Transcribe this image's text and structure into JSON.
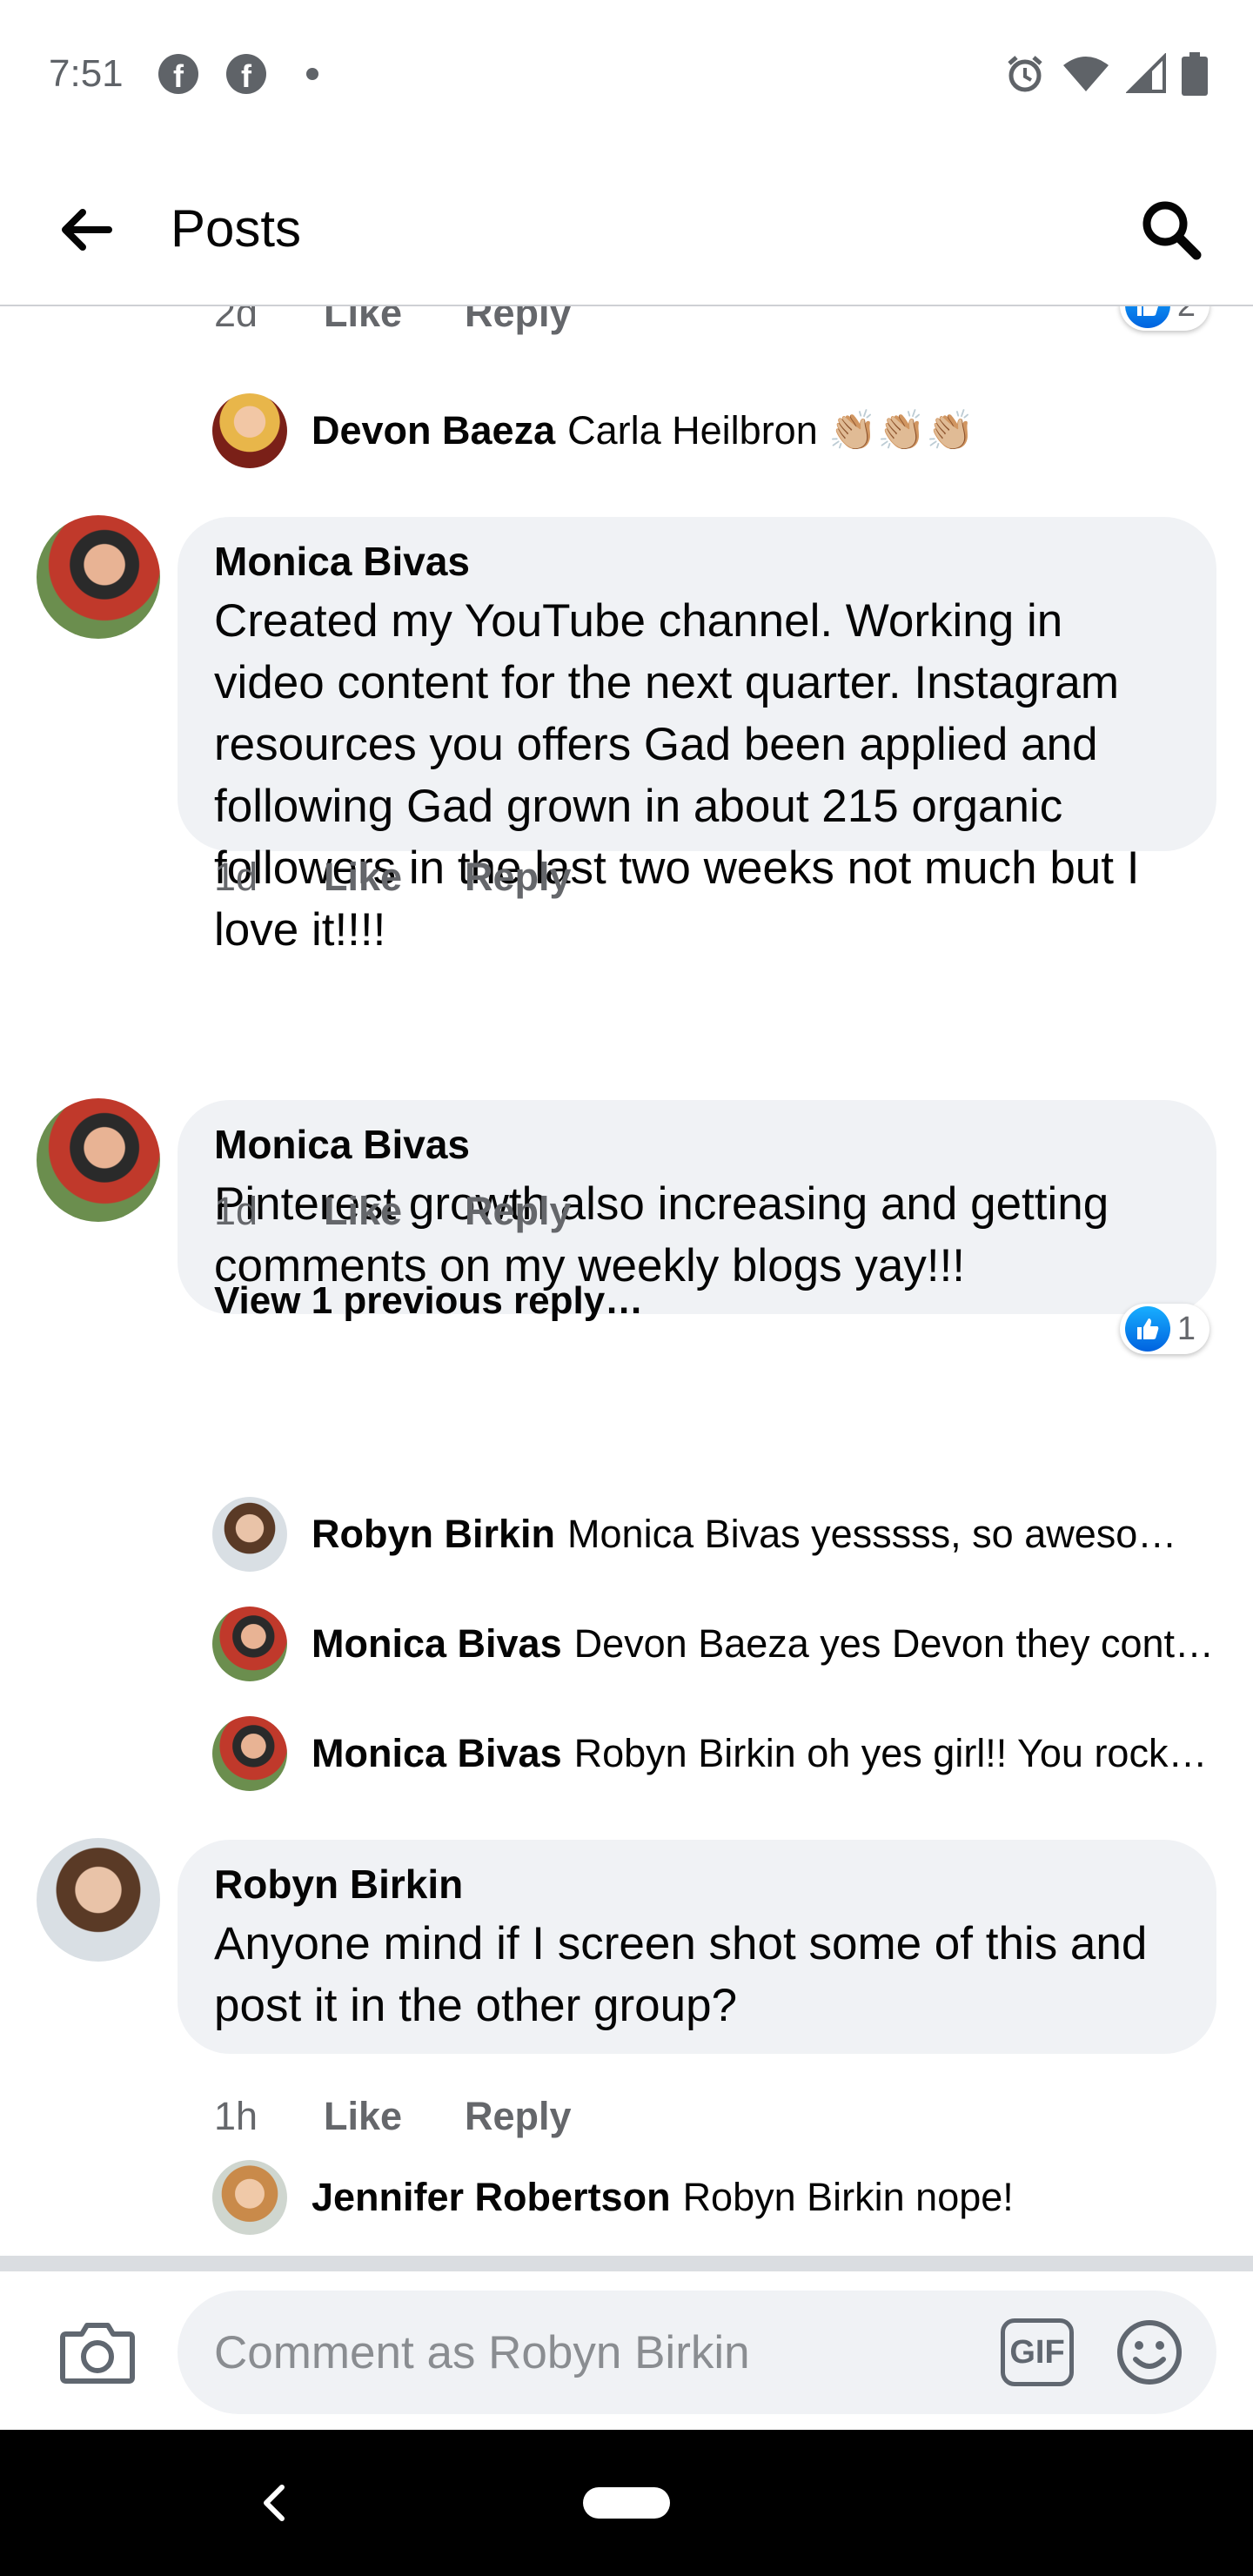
{
  "status_bar": {
    "time": "7:51",
    "notification_icons": [
      "facebook-icon",
      "facebook-icon",
      "dot-icon"
    ],
    "system_icons": [
      "alarm-icon",
      "wifi-icon",
      "signal-icon",
      "battery-icon"
    ]
  },
  "header": {
    "title": "Posts",
    "back_icon": "arrow-left-icon",
    "search_icon": "search-icon"
  },
  "top_comment_tail": {
    "time": "2d",
    "like": "Like",
    "reply": "Reply",
    "reaction_count": "2"
  },
  "reply_devon": {
    "author": "Devon Baeza",
    "text": "Carla Heilbron 👏🏼👏🏼👏🏼"
  },
  "comments": [
    {
      "author": "Monica Bivas",
      "text": "Created my YouTube channel. Working in video content for the next quarter. Instagram resources you offers Gad been applied and following Gad grown in about 215 organic followers in the last two weeks not much but I love it!!!!",
      "time": "1d",
      "like": "Like",
      "reply": "Reply"
    },
    {
      "author": "Monica Bivas",
      "text": "Pinterest growth also increasing and getting comments on my weekly blogs yay!!!",
      "time": "1d",
      "like": "Like",
      "reply": "Reply",
      "reaction_count": "1",
      "view_previous": "View 1 previous reply…",
      "replies": [
        {
          "author": "Robyn Birkin",
          "text": "Monica Bivas yesssss, so aweso…"
        },
        {
          "author": "Monica Bivas",
          "text": "Devon Baeza yes Devon they cont…"
        },
        {
          "author": "Monica Bivas",
          "text": "Robyn Birkin oh yes girl!! You rock…"
        }
      ]
    },
    {
      "author": "Robyn Birkin",
      "text": "Anyone mind if I screen shot some of this and post it in the other group?",
      "time": "1h",
      "like": "Like",
      "reply": "Reply",
      "replies": [
        {
          "author": "Jennifer Robertson",
          "text": "Robyn Birkin nope!"
        }
      ]
    }
  ],
  "composer": {
    "placeholder": "Comment as Robyn Birkin",
    "gif_label": "GIF",
    "camera_icon": "camera-icon",
    "emoji_icon": "emoji-icon"
  },
  "colors": {
    "bubble": "#f0f2f5",
    "secondary_text": "#65676b",
    "like_blue": "#1877f2",
    "nav_bar": "#000000"
  }
}
